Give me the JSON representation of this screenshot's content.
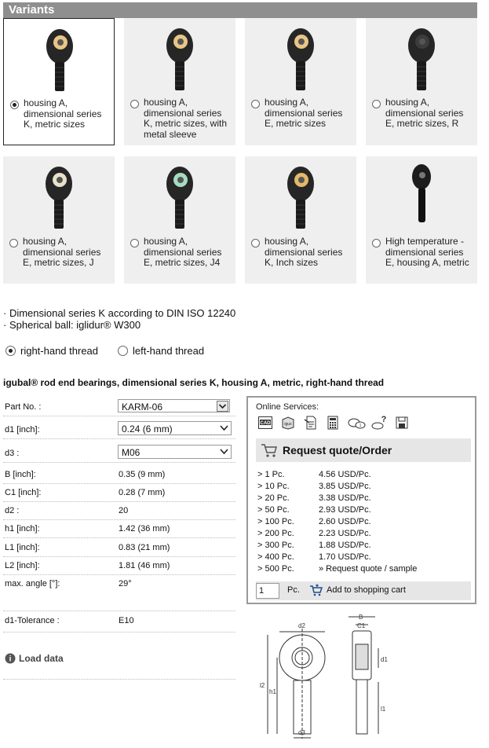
{
  "section_title": "Variants",
  "variants": [
    {
      "label": "housing A, dimensional series K, metric sizes",
      "lines": [
        "housing A,",
        "dimensional series",
        "K, metric sizes"
      ],
      "selected": true,
      "insert_color": "#e9c586"
    },
    {
      "label": "housing A, dimensional series K, metric sizes, with metal sleeve",
      "lines": [
        "housing A,",
        "dimensional series",
        "K, metric sizes, with",
        "metal sleeve"
      ],
      "selected": false,
      "insert_color": "#e9c586"
    },
    {
      "label": "housing A, dimensional series E, metric sizes",
      "lines": [
        "housing A,",
        "dimensional series",
        "E, metric sizes"
      ],
      "selected": false,
      "insert_color": "#e9c586"
    },
    {
      "label": "housing A, dimensional series E, metric sizes, R",
      "lines": [
        "housing A,",
        "dimensional series",
        "E, metric sizes, R"
      ],
      "selected": false,
      "insert_color": "#3c3c3c"
    },
    {
      "label": "housing A, dimensional series E, metric sizes, J",
      "lines": [
        "housing A,",
        "dimensional series",
        "E, metric sizes, J"
      ],
      "selected": false,
      "insert_color": "#e9e2c8"
    },
    {
      "label": "housing A, dimensional series E, metric sizes, J4",
      "lines": [
        "housing A,",
        "dimensional series",
        "E, metric sizes, J4"
      ],
      "selected": false,
      "insert_color": "#a6dcc0"
    },
    {
      "label": "housing A, dimensional series K, Inch sizes",
      "lines": [
        "housing A,",
        "dimensional series",
        "K, Inch sizes"
      ],
      "selected": false,
      "insert_color": "#e2b86a"
    },
    {
      "label": "High temperature - dimensional series E, housing A, metric",
      "lines": [
        "High temperature -",
        "dimensional series",
        "E, housing A, metric"
      ],
      "selected": false,
      "insert_color": "#1a1a1a"
    }
  ],
  "bullets": [
    "Dimensional series K according to DIN ISO 12240",
    "Spherical ball: iglidur® W300"
  ],
  "thread": {
    "right": "right-hand thread",
    "left": "left-hand thread"
  },
  "product_title": "igubal® rod end bearings, dimensional series K, housing A, metric, right-hand thread",
  "part_no": {
    "label": "Part No. :",
    "value": "KARM-06"
  },
  "d1": {
    "label": "d1 [inch]:",
    "value": "0.24 (6 mm)"
  },
  "d3": {
    "label": "d3 :",
    "value": "M06"
  },
  "props": [
    {
      "label": "B [inch]:",
      "value": "0.35 (9 mm)"
    },
    {
      "label": "C1 [inch]:",
      "value": "0.28 (7 mm)"
    },
    {
      "label": "d2 :",
      "value": "20"
    },
    {
      "label": "h1 [inch]:",
      "value": "1.42 (36 mm)"
    },
    {
      "label": "L1 [inch]:",
      "value": "0.83 (21 mm)"
    },
    {
      "label": "L2 [inch]:",
      "value": "1.81 (46 mm)"
    },
    {
      "label": "max. angle [°]:",
      "value": "29°"
    }
  ],
  "tolerance": {
    "label": "d1-Tolerance :",
    "value": "E10"
  },
  "load_data": "Load data",
  "services": {
    "title": "Online Services:",
    "icons": [
      "cad-icon",
      "igus-box-icon",
      "document-icon",
      "calculator-icon",
      "lifetime-calculator-icon",
      "help-icon",
      "save-icon"
    ],
    "request_title": "Request quote/Order",
    "prices": [
      {
        "qty": "> 1 Pc.",
        "price": "4.56 USD/Pc."
      },
      {
        "qty": "> 10 Pc.",
        "price": "3.85 USD/Pc."
      },
      {
        "qty": "> 20 Pc.",
        "price": "3.38 USD/Pc."
      },
      {
        "qty": "> 50 Pc.",
        "price": "2.93 USD/Pc."
      },
      {
        "qty": "> 100 Pc.",
        "price": "2.60 USD/Pc."
      },
      {
        "qty": "> 200 Pc.",
        "price": "2.23 USD/Pc."
      },
      {
        "qty": "> 300 Pc.",
        "price": "1.88 USD/Pc."
      },
      {
        "qty": "> 400 Pc.",
        "price": "1.70 USD/Pc."
      },
      {
        "qty": "> 500 Pc.",
        "price": "» Request quote / sample"
      }
    ],
    "quantity": "1",
    "pc": "Pc.",
    "add_to_cart": "Add to shopping cart"
  },
  "drawing": {
    "d2": "d2",
    "d1": "d1",
    "d3": "d3",
    "l2": "l2",
    "h1": "h1",
    "l1": "l1",
    "B": "B",
    "C1": "C1"
  }
}
